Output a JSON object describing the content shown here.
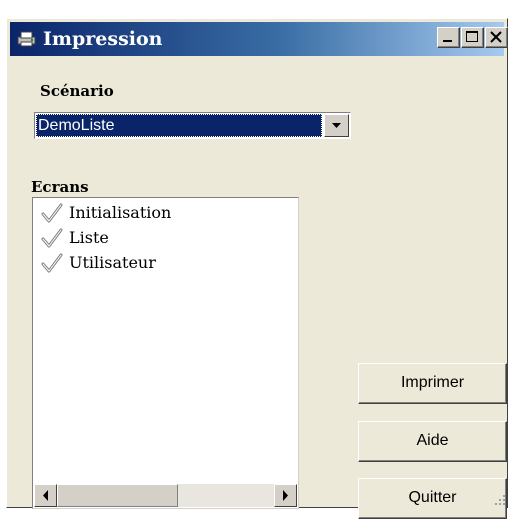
{
  "window": {
    "title": "Impression"
  },
  "titlebar": {
    "app_icon": "printer-icon",
    "buttons": [
      "minimize-icon",
      "maximize-icon",
      "close-icon"
    ]
  },
  "scenario": {
    "label": "Scénario",
    "selected": "DemoListe"
  },
  "ecrans": {
    "label": "Ecrans",
    "items": [
      {
        "label": "Initialisation",
        "checked": true
      },
      {
        "label": "Liste",
        "checked": true
      },
      {
        "label": "Utilisateur",
        "checked": true
      }
    ]
  },
  "actions": {
    "print": "Imprimer",
    "help": "Aide",
    "quit": "Quitter"
  },
  "colors": {
    "titlebar_start": "#0a246a",
    "titlebar_end": "#a6caf0",
    "selection": "#0a246a",
    "face": "#ece9d8"
  }
}
